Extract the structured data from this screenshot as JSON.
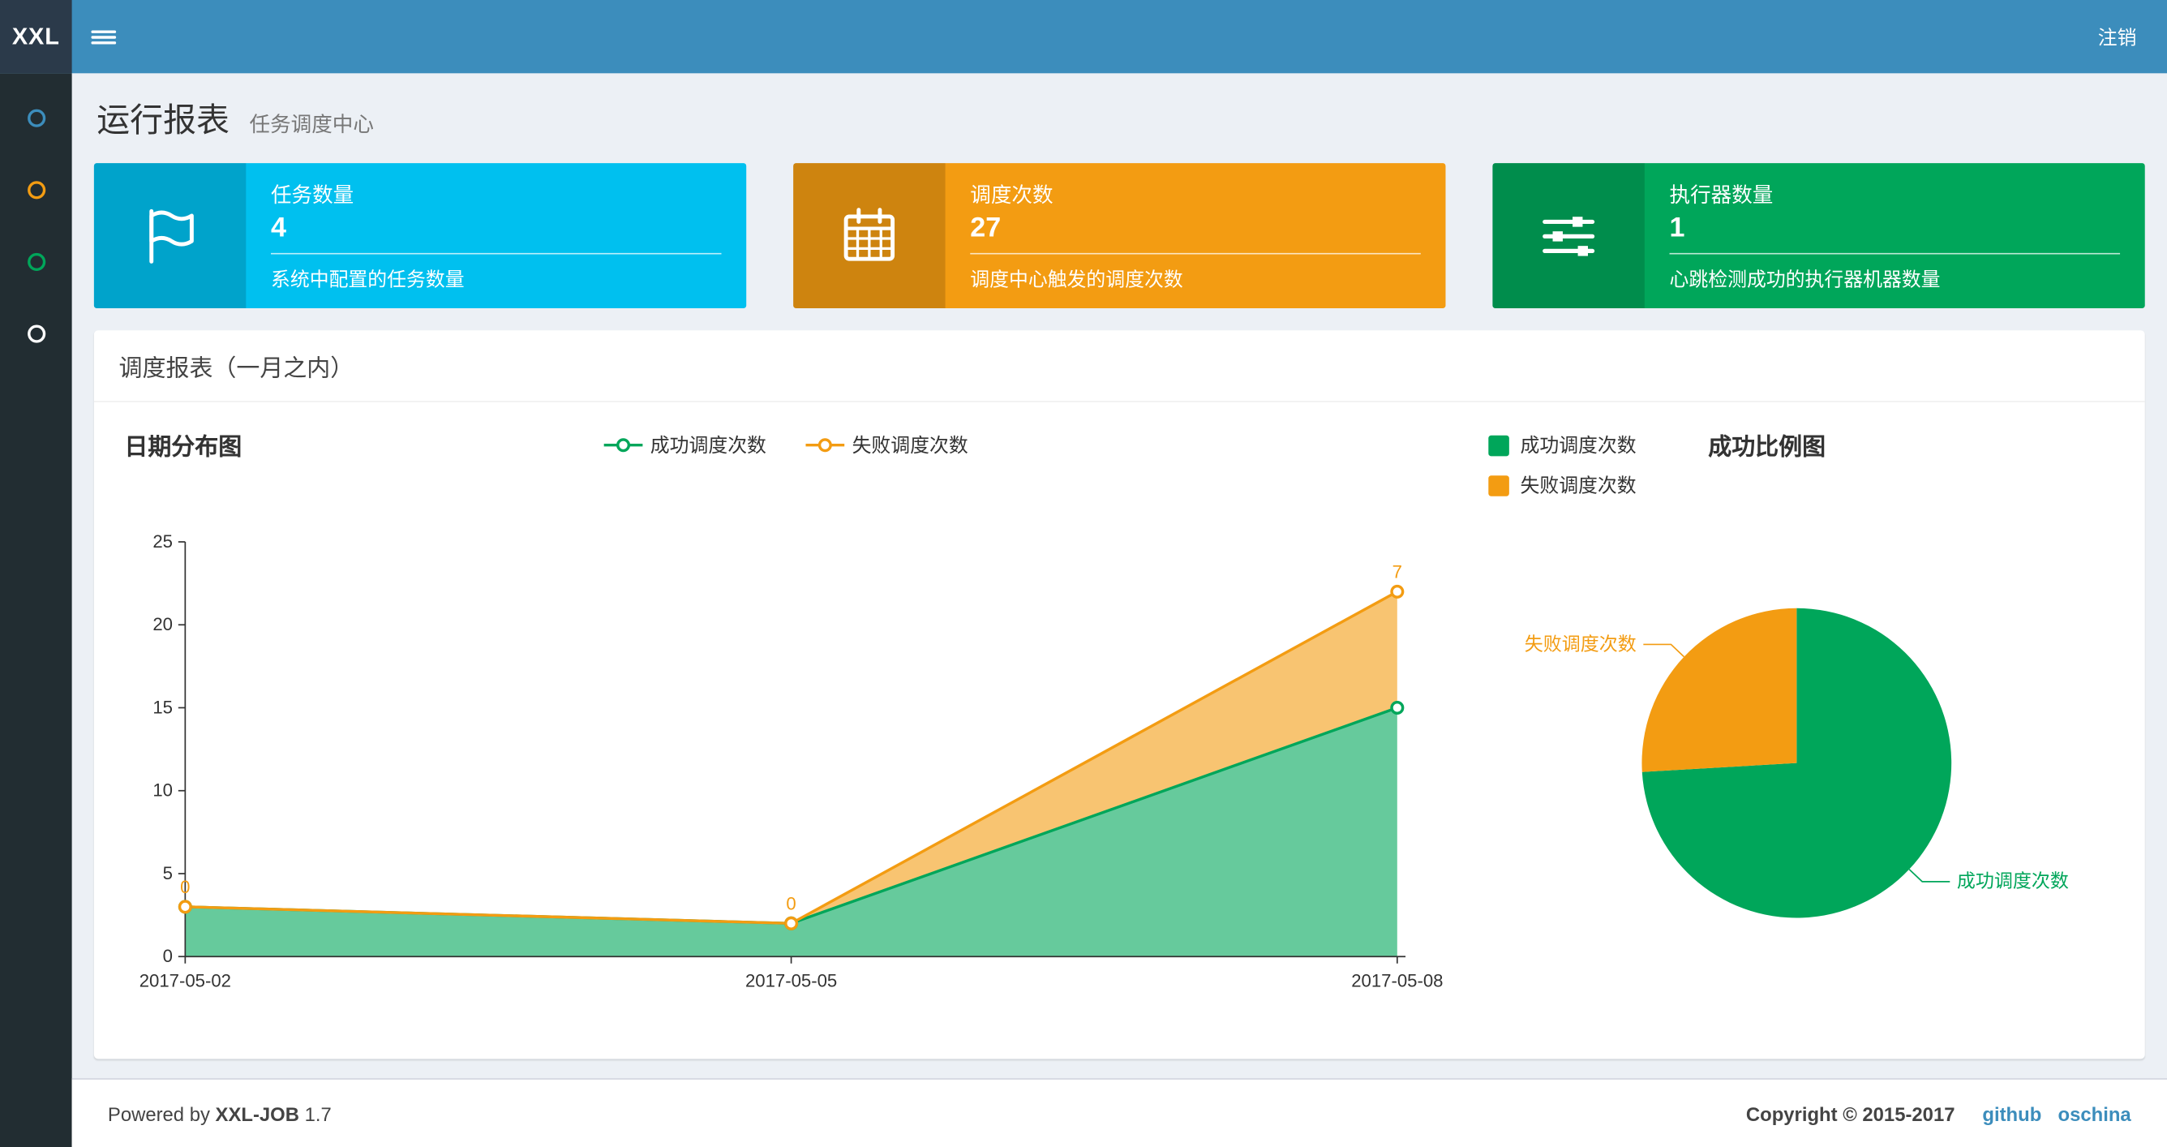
{
  "navbar": {
    "logo": "XXL",
    "logout_label": "注销"
  },
  "sidebar": {
    "items": [
      {
        "icon": "circle-icon",
        "color": "#3c8dbc"
      },
      {
        "icon": "circle-icon",
        "color": "#f39c12"
      },
      {
        "icon": "circle-icon",
        "color": "#00a65a"
      },
      {
        "icon": "circle-icon",
        "color": "#ffffff"
      }
    ]
  },
  "header": {
    "title": "运行报表",
    "subtitle": "任务调度中心"
  },
  "info_boxes": [
    {
      "title": "任务数量",
      "value": "4",
      "description": "系统中配置的任务数量",
      "bg": "#00c0ef",
      "icon": "flag-icon"
    },
    {
      "title": "调度次数",
      "value": "27",
      "description": "调度中心触发的调度次数",
      "bg": "#f39c12",
      "icon": "calendar-icon"
    },
    {
      "title": "执行器数量",
      "value": "1",
      "description": "心跳检测成功的执行器机器数量",
      "bg": "#00a65a",
      "icon": "sliders-icon"
    }
  ],
  "panel": {
    "title": "调度报表（一月之内）"
  },
  "chart_data": [
    {
      "type": "area",
      "title": "日期分布图",
      "x": [
        "2017-05-02",
        "2017-05-05",
        "2017-05-08"
      ],
      "series": [
        {
          "name": "成功调度次数",
          "values": [
            3,
            2,
            15
          ],
          "color": "#00a65a",
          "stack": true
        },
        {
          "name": "失败调度次数",
          "values": [
            0,
            0,
            7
          ],
          "color": "#f39c12",
          "stack": true,
          "data_labels": [
            0,
            0,
            7
          ]
        }
      ],
      "ylim": [
        0,
        25
      ],
      "yticks": [
        0,
        5,
        10,
        15,
        20,
        25
      ],
      "legend": [
        "成功调度次数",
        "失败调度次数"
      ],
      "legend_position": "top-center",
      "grid": false
    },
    {
      "type": "pie",
      "title": "成功比例图",
      "slices": [
        {
          "label": "成功调度次数",
          "value": 20,
          "color": "#00a65a"
        },
        {
          "label": "失败调度次数",
          "value": 7,
          "color": "#f39c12"
        }
      ],
      "legend_position": "top-left"
    }
  ],
  "footer": {
    "powered_by_prefix": "Powered by",
    "brand": "XXL-JOB",
    "version": "1.7",
    "copyright": "Copyright © 2015-2017",
    "links": [
      {
        "label": "github"
      },
      {
        "label": "oschina"
      }
    ]
  }
}
